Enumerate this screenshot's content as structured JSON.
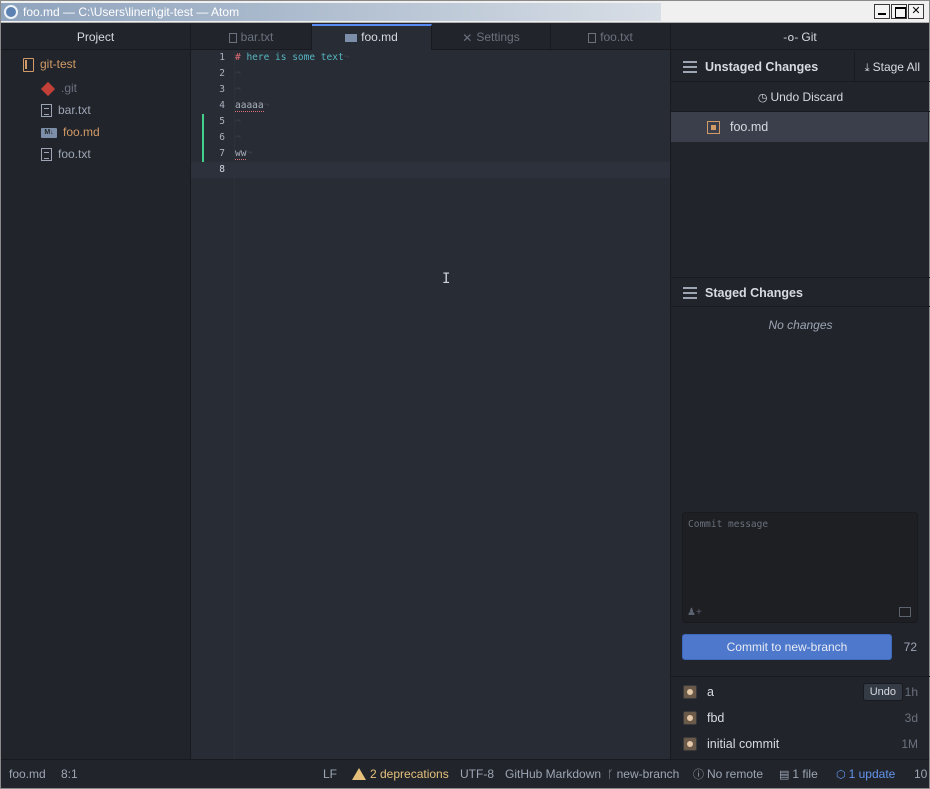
{
  "window": {
    "title": "foo.md — C:\\Users\\lineri\\git-test — Atom"
  },
  "tree": {
    "header": "Project",
    "root": "git-test",
    "items": [
      {
        "label": ".git",
        "icon": "git-icon"
      },
      {
        "label": "bar.txt",
        "icon": "file-icon"
      },
      {
        "label": "foo.md",
        "icon": "markdown-icon"
      },
      {
        "label": "foo.txt",
        "icon": "file-icon"
      }
    ]
  },
  "tabs": [
    {
      "label": "bar.txt",
      "icon": "file-icon"
    },
    {
      "label": "foo.md",
      "icon": "markdown-icon",
      "active": true
    },
    {
      "label": "Settings",
      "icon": "tools-icon"
    },
    {
      "label": "foo.txt",
      "icon": "file-icon"
    }
  ],
  "editor": {
    "line_numbers": [
      "1",
      "2",
      "3",
      "4",
      "5",
      "6",
      "7",
      "8"
    ],
    "lines": [
      {
        "hash": "# ",
        "text": "here is some text",
        "eol": "¬"
      },
      {
        "text": "",
        "eol": "¬"
      },
      {
        "text": "",
        "eol": "¬"
      },
      {
        "text": "aaaaa",
        "eol": "¬"
      },
      {
        "text": "",
        "eol": "¬"
      },
      {
        "text": "",
        "eol": "¬"
      },
      {
        "text": "ww",
        "eol": "¬"
      },
      {
        "text": "",
        "eol": ""
      }
    ]
  },
  "git": {
    "header": "Git",
    "unstaged_title": "Unstaged Changes",
    "stage_all": "Stage All",
    "undo_discard": "Undo Discard",
    "unstaged_files": [
      "foo.md"
    ],
    "staged_title": "Staged Changes",
    "no_changes": "No changes",
    "commit_placeholder": "Commit message",
    "commit_button": "Commit to new-branch",
    "chars_remaining": "72",
    "recent_commits": [
      {
        "message": "a",
        "age": "1h",
        "undo": "Undo"
      },
      {
        "message": "fbd",
        "age": "3d"
      },
      {
        "message": "initial commit",
        "age": "1M"
      }
    ]
  },
  "status": {
    "file": "foo.md",
    "cursor": "8:1",
    "line_ending": "LF",
    "deprecations": "2 deprecations",
    "encoding": "UTF-8",
    "grammar": "GitHub Markdown",
    "branch": "new-branch",
    "remote": "No remote",
    "files_changed": "1 file",
    "updates": "1 update",
    "trailing": "10"
  },
  "colors": {
    "accent": "#568af2",
    "commit_button": "#4d78cc",
    "modified": "#d19a66",
    "added_gutter": "#43d08a"
  }
}
